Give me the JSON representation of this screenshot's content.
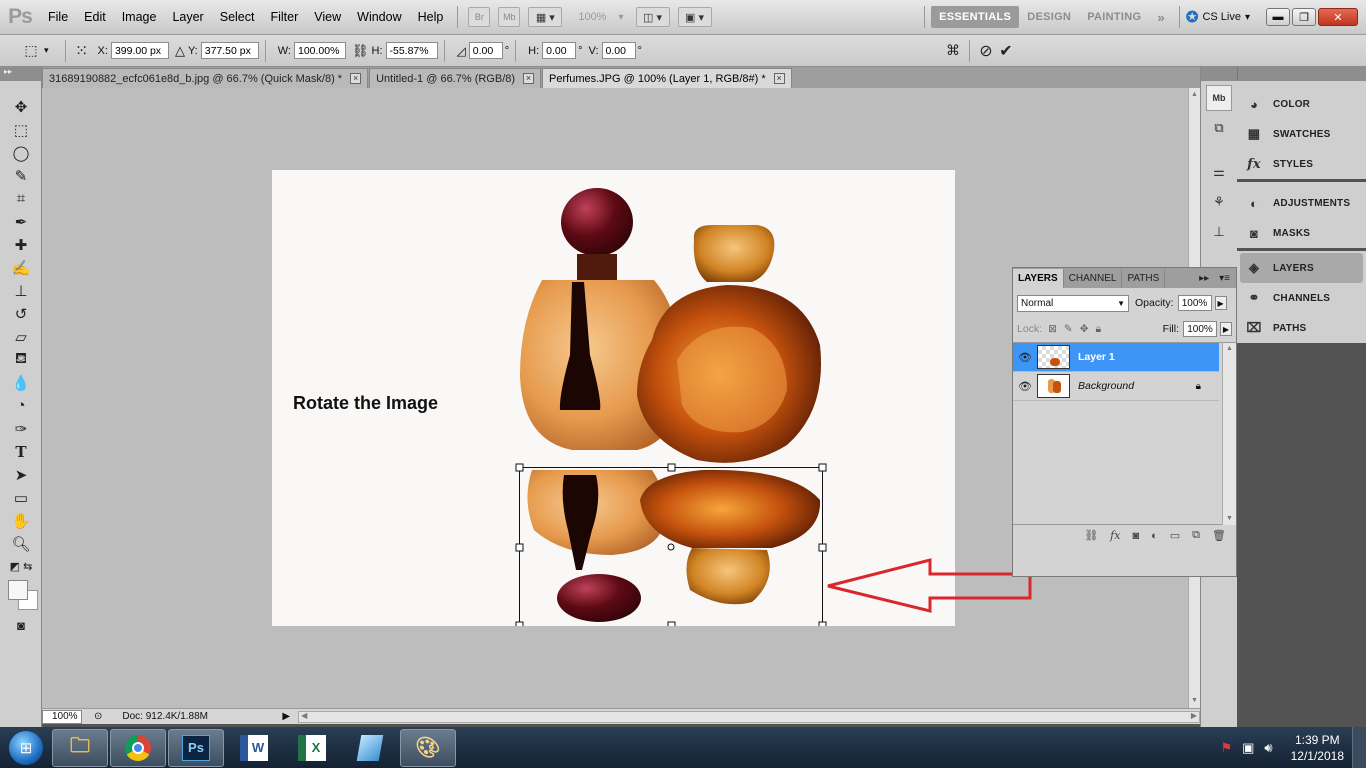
{
  "app": {
    "logo": "Ps"
  },
  "menu": [
    "File",
    "Edit",
    "Image",
    "Layer",
    "Select",
    "Filter",
    "View",
    "Window",
    "Help"
  ],
  "menubar": {
    "zoom": "100%",
    "bridge": "Br",
    "minibridge": "Mb",
    "workspaces": [
      "ESSENTIALS",
      "DESIGN",
      "PAINTING"
    ],
    "active_workspace": "ESSENTIALS",
    "overflow": "»",
    "cs_live": "CS Live"
  },
  "options": {
    "x_label": "X:",
    "x_value": "399.00 px",
    "y_label": "Y:",
    "y_value": "377.50 px",
    "w_label": "W:",
    "w_value": "100.00%",
    "h_label": "H:",
    "h_value": "-55.87%",
    "rot_value": "0.00",
    "hskew_label": "H:",
    "hskew_value": "0.00",
    "vskew_label": "V:",
    "vskew_value": "0.00"
  },
  "tabs": [
    {
      "label": "31689190882_ecfc061e8d_b.jpg @ 66.7% (Quick Mask/8) *",
      "active": false
    },
    {
      "label": "Untitled-1 @ 66.7% (RGB/8)",
      "active": false
    },
    {
      "label": "Perfumes.JPG @ 100% (Layer 1, RGB/8#) *",
      "active": true
    }
  ],
  "canvas": {
    "annotation": "Rotate the Image",
    "arrow_color": "#d9272e"
  },
  "status": {
    "zoom": "100%",
    "doc": "Doc: 912.4K/1.88M"
  },
  "dock": {
    "groups": [
      [
        {
          "label": "COLOR",
          "icon": "color-icon"
        },
        {
          "label": "SWATCHES",
          "icon": "swatches-icon"
        },
        {
          "label": "STYLES",
          "icon": "styles-icon"
        }
      ],
      [
        {
          "label": "ADJUSTMENTS",
          "icon": "adjustments-icon"
        },
        {
          "label": "MASKS",
          "icon": "masks-icon"
        }
      ],
      [
        {
          "label": "LAYERS",
          "icon": "layers-icon",
          "active": true
        },
        {
          "label": "CHANNELS",
          "icon": "channels-icon"
        },
        {
          "label": "PATHS",
          "icon": "paths-icon"
        }
      ]
    ]
  },
  "layers_panel": {
    "tabs": [
      "LAYERS",
      "CHANNEL",
      "PATHS"
    ],
    "blend_mode": "Normal",
    "opacity_label": "Opacity:",
    "opacity": "100%",
    "lock_label": "Lock:",
    "fill_label": "Fill:",
    "fill": "100%",
    "layers": [
      {
        "name": "Layer 1",
        "selected": true
      },
      {
        "name": "Background",
        "selected": false
      }
    ]
  },
  "taskbar": {
    "apps": [
      "explorer",
      "chrome",
      "photoshop",
      "word",
      "excel",
      "app",
      "paint"
    ],
    "time": "1:39 PM",
    "date": "12/1/2018"
  },
  "colors": {
    "accent": "#3d96f5",
    "panel": "#d3d3d3",
    "workspace": "#bdbdbd"
  }
}
